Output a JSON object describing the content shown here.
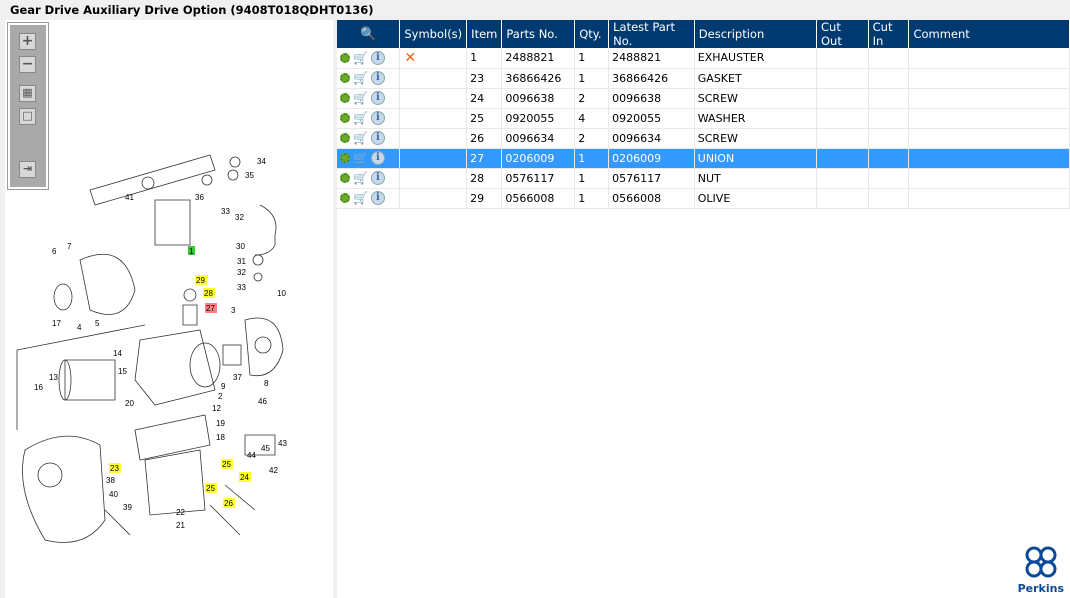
{
  "title": "Gear Drive Auxiliary Drive Option (9408T018QDHT0136)",
  "toolbar": {
    "zoom_in": "+",
    "zoom_out": "−",
    "fit": "▦",
    "actual": "□",
    "export": "⇥"
  },
  "table": {
    "headers": [
      "",
      "Symbol(s)",
      "Item",
      "Parts No.",
      "Qty.",
      "Latest Part No.",
      "Description",
      "Cut Out",
      "Cut In",
      "Comment"
    ],
    "rows": [
      {
        "symbol": "✕",
        "item": "1",
        "part": "2488821",
        "qty": "1",
        "latest": "2488821",
        "desc": "EXHAUSTER"
      },
      {
        "symbol": "",
        "item": "23",
        "part": "36866426",
        "qty": "1",
        "latest": "36866426",
        "desc": "GASKET"
      },
      {
        "symbol": "",
        "item": "24",
        "part": "0096638",
        "qty": "2",
        "latest": "0096638",
        "desc": "SCREW"
      },
      {
        "symbol": "",
        "item": "25",
        "part": "0920055",
        "qty": "4",
        "latest": "0920055",
        "desc": "WASHER"
      },
      {
        "symbol": "",
        "item": "26",
        "part": "0096634",
        "qty": "2",
        "latest": "0096634",
        "desc": "SCREW"
      },
      {
        "symbol": "",
        "item": "27",
        "part": "0206009",
        "qty": "1",
        "latest": "0206009",
        "desc": "UNION"
      },
      {
        "symbol": "",
        "item": "28",
        "part": "0576117",
        "qty": "1",
        "latest": "0576117",
        "desc": "NUT"
      },
      {
        "symbol": "",
        "item": "29",
        "part": "0566008",
        "qty": "1",
        "latest": "0566008",
        "desc": "OLIVE"
      }
    ],
    "selected_item": "27"
  },
  "callouts": [
    "34",
    "35",
    "41",
    "36",
    "33",
    "32",
    "30",
    "31",
    "32",
    "33",
    "10",
    "1",
    "6",
    "7",
    "17",
    "4",
    "5",
    "29",
    "28",
    "27",
    "3",
    "14",
    "13",
    "15",
    "16",
    "9",
    "37",
    "8",
    "2",
    "12",
    "20",
    "19",
    "18",
    "46",
    "43",
    "45",
    "44",
    "42",
    "23",
    "25",
    "24",
    "25",
    "26",
    "38",
    "40",
    "39",
    "22",
    "21"
  ],
  "brand": "Perkins",
  "colors": {
    "header": "#003a70",
    "selected": "#3399ff",
    "highlight": "#ffff33",
    "active": "#ff8080",
    "green": "#33cc33"
  }
}
